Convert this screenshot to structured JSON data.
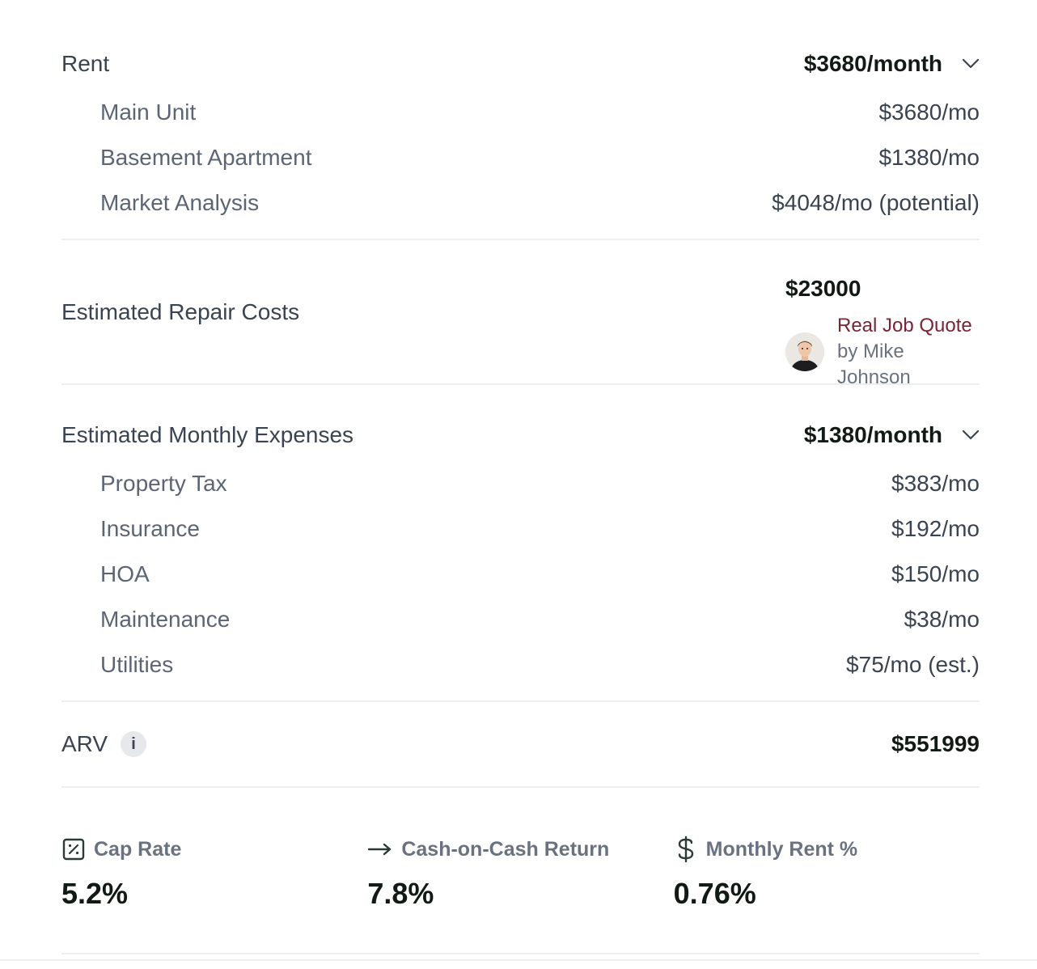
{
  "rent": {
    "label": "Rent",
    "total": "$3680/month",
    "items": [
      {
        "label": "Main Unit",
        "value": "$3680/mo"
      },
      {
        "label": "Basement Apartment",
        "value": "$1380/mo"
      },
      {
        "label": "Market Analysis",
        "value": "$4048/mo (potential)"
      }
    ]
  },
  "repair": {
    "label": "Estimated Repair Costs",
    "amount": "$23000",
    "quote_link": "Real Job Quote",
    "quote_by": "by Mike Johnson"
  },
  "expenses": {
    "label": "Estimated Monthly Expenses",
    "total": "$1380/month",
    "items": [
      {
        "label": "Property Tax",
        "value": "$383/mo"
      },
      {
        "label": "Insurance",
        "value": "$192/mo"
      },
      {
        "label": "HOA",
        "value": "$150/mo"
      },
      {
        "label": "Maintenance",
        "value": "$38/mo"
      },
      {
        "label": "Utilities",
        "value": "$75/mo (est.)"
      }
    ]
  },
  "arv": {
    "label": "ARV",
    "info_glyph": "i",
    "value": "$551999"
  },
  "metrics": [
    {
      "icon": "percent-square-icon",
      "label": "Cap Rate",
      "value": "5.2%"
    },
    {
      "icon": "arrow-right-icon",
      "label": "Cash-on-Cash Return",
      "value": "7.8%"
    },
    {
      "icon": "dollar-icon",
      "label": "Monthly Rent %",
      "value": "0.76%"
    }
  ],
  "colors": {
    "accent_link": "#7a2436",
    "value_text": "#111a14",
    "label_text": "#3a4350",
    "muted_text": "#6a7280",
    "divider": "#eceef0"
  }
}
